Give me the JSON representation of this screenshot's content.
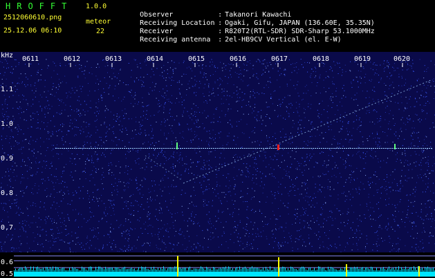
{
  "header": {
    "app_title": "HROFFT",
    "app_version": "1.0.0",
    "file_name": "2512060610.png",
    "datetime": "25.12.06 06:10",
    "meteor_label": "meteor",
    "meteor_count": "22"
  },
  "info": [
    {
      "key": "Observer",
      "sep": ":",
      "value": "Takanori Kawachi"
    },
    {
      "key": "Receiving Location",
      "sep": ":",
      "value": "Ogaki, Gifu, JAPAN (136.60E, 35.35N)"
    },
    {
      "key": "Receiver",
      "sep": ":",
      "value": "R820T2(RTL-SDR) SDR-Sharp 53.1000MHz"
    },
    {
      "key": "Receiving antenna",
      "sep": ":",
      "value": "2el-HB9CV Vertical (el. E-W)"
    }
  ],
  "spectrogram": {
    "unit": "kHz",
    "time_ticks": [
      "0611",
      "0612",
      "0613",
      "0614",
      "0615",
      "0616",
      "0617",
      "0618",
      "0619",
      "0620"
    ],
    "freq_ticks": [
      "1.1",
      "1.0",
      "0.9",
      "0.8",
      "0.7",
      "0.6",
      "0.5"
    ],
    "colors": {
      "background": "#0a0a4a",
      "noise": "#3a5aff",
      "signal": "#a0d0ff",
      "meteor": "#ff2020",
      "level": "#00e5ff",
      "spike": "#ffff00"
    }
  }
}
